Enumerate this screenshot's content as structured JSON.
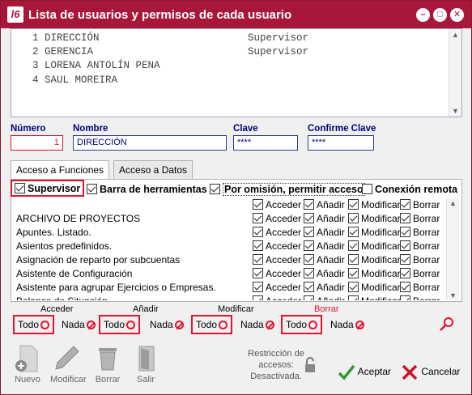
{
  "window": {
    "title": "Lista de usuarios y permisos de cada usuario",
    "app_icon_text": "l6",
    "controls": [
      "minimize",
      "maximize",
      "close"
    ]
  },
  "users": [
    {
      "num": "1",
      "name": "DIRECCIÓN",
      "role": "Supervisor"
    },
    {
      "num": "2",
      "name": "GERENCIA",
      "role": "Supervisor"
    },
    {
      "num": "3",
      "name": "LORENA ANTOLÍN PENA",
      "role": ""
    },
    {
      "num": "4",
      "name": "SAUL MOREIRA",
      "role": ""
    }
  ],
  "fields": {
    "numero_label": "Número",
    "numero_value": "1",
    "nombre_label": "Nombre",
    "nombre_value": "DIRECCIÓN",
    "clave_label": "Clave",
    "clave_value": "****",
    "confirme_label": "Confirme Clave",
    "confirme_value": "****"
  },
  "tabs": [
    {
      "label": "Acceso a Funciones",
      "active": true
    },
    {
      "label": "Acceso a Datos",
      "active": false
    }
  ],
  "options": {
    "supervisor": {
      "label": "Supervisor",
      "checked": true
    },
    "barra": {
      "label": "Barra de herramientas",
      "checked": true
    },
    "omision": {
      "label": "Por omisión, permitir acceso",
      "checked": true
    },
    "conexion": {
      "label": "Conexión remota",
      "checked": false
    }
  },
  "permission_columns": [
    "Acceder",
    "Añadir",
    "Modificar",
    "Borrar"
  ],
  "permissions": [
    {
      "name": "",
      "acceder": true,
      "anadir": true,
      "modificar": true,
      "borrar": true
    },
    {
      "name": "ARCHIVO DE PROYECTOS",
      "acceder": true,
      "anadir": true,
      "modificar": true,
      "borrar": true
    },
    {
      "name": "Apuntes. Listado.",
      "acceder": true,
      "anadir": true,
      "modificar": true,
      "borrar": true
    },
    {
      "name": "Asientos predefinidos.",
      "acceder": true,
      "anadir": true,
      "modificar": true,
      "borrar": true
    },
    {
      "name": "Asignación de reparto por subcuentas",
      "acceder": true,
      "anadir": true,
      "modificar": true,
      "borrar": true
    },
    {
      "name": "Asistente de Configuración",
      "acceder": true,
      "anadir": true,
      "modificar": true,
      "borrar": true
    },
    {
      "name": "Asistente para agrupar Ejercicios o Empresas.",
      "acceder": true,
      "anadir": true,
      "modificar": true,
      "borrar": true
    },
    {
      "name": "Balance de Situación",
      "acceder": true,
      "anadir": true,
      "modificar": true,
      "borrar": true
    }
  ],
  "groups": {
    "acceder": {
      "label": "Acceder",
      "todo": "Todo",
      "nada": "Nada"
    },
    "anadir": {
      "label": "Añadir",
      "todo": "Todo",
      "nada": "Nada"
    },
    "modificar": {
      "label": "Modificar",
      "todo": "Todo",
      "nada": "Nada"
    },
    "borrar": {
      "label": "Borrar",
      "todo": "Todo",
      "nada": "Nada",
      "color": "#e4132e"
    }
  },
  "toolbar": {
    "nuevo": "Nuevo",
    "modificar": "Modificar",
    "borrar": "Borrar",
    "salir": "Salir",
    "restriccion": "Restricción de accesos: Desactivada.",
    "aceptar": "Aceptar",
    "cancelar": "Cancelar"
  },
  "colors": {
    "titlebar": "#a8173a",
    "highlight": "#e4132e",
    "field_border": "#2b3b8f",
    "accept": "#2e9a2e",
    "cancel": "#d0122b"
  }
}
